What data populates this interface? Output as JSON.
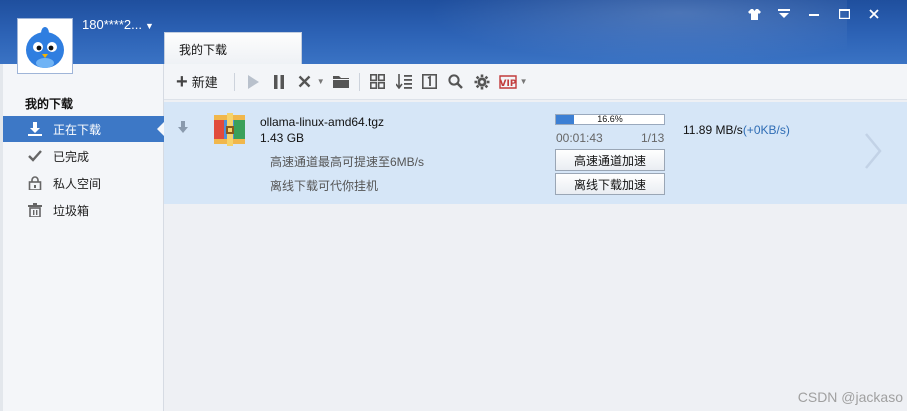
{
  "user": {
    "name": "180****2...",
    "caret": "▼"
  },
  "tab": {
    "label": "我的下载"
  },
  "sidebar": {
    "title": "我的下载",
    "items": [
      {
        "label": "正在下载",
        "icon": "download-icon",
        "active": true
      },
      {
        "label": "已完成",
        "icon": "check-icon",
        "active": false
      },
      {
        "label": "私人空间",
        "icon": "lock-icon",
        "active": false
      },
      {
        "label": "垃圾箱",
        "icon": "trash-icon",
        "active": false
      }
    ]
  },
  "toolbar": {
    "new_label": "新建",
    "icons": [
      "play-icon",
      "pause-icon",
      "delete-icon",
      "folder-icon",
      "grid-view-icon",
      "sort-icon",
      "task-count-icon",
      "search-icon",
      "settings-icon",
      "vip-icon"
    ]
  },
  "task": {
    "filename": "ollama-linux-amd64.tgz",
    "size": "1.43 GB",
    "progress_percent": 16.6,
    "progress_text": "16.6%",
    "elapsed": "00:01:43",
    "pieces": "1/13",
    "speed": "11.89  MB/s",
    "speed_delta": "(+0KB/s)",
    "hint1": "高速通道最高可提速至6MB/s",
    "hint2": "离线下载可代你挂机",
    "btn_fast": "高速通道加速",
    "btn_offline": "离线下载加速"
  },
  "watermark": "CSDN @jackaso",
  "colors": {
    "accent": "#3d78c6",
    "row_bg": "#d6e6f7",
    "progress": "#3c7fd4"
  }
}
